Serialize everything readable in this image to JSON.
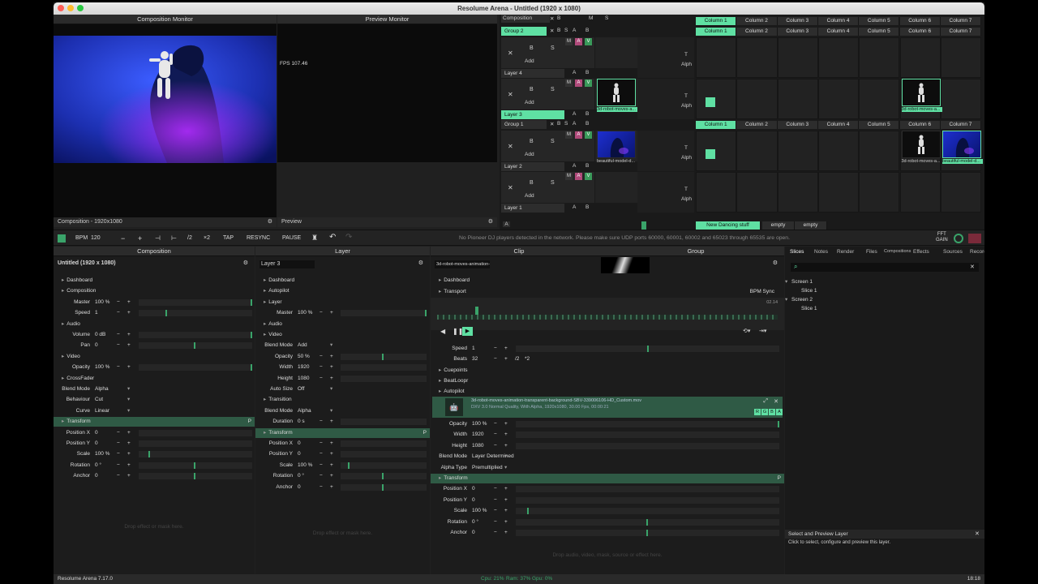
{
  "window": {
    "title": "Resolume Arena - Untitled (1920 x 1080)"
  },
  "monitors": {
    "composition_title": "Composition Monitor",
    "preview_title": "Preview Monitor",
    "fps": "FPS 107.46",
    "composition_footer": "Composition - 1920x1080",
    "preview_footer": "Preview"
  },
  "deck": {
    "comp_label": "Composition",
    "groups": [
      "Group 2",
      "Group 1"
    ],
    "layers": [
      "Layer 4",
      "Layer 3",
      "Layer 2",
      "Layer 1"
    ],
    "columns": [
      "Column 1",
      "Column 2",
      "Column 3",
      "Column 4",
      "Column 5",
      "Column 6",
      "Column 7"
    ],
    "clip_names": {
      "robot": "3d-robot-moves-a...",
      "model": "beautiful-model-d..."
    },
    "btn_labels": {
      "x": "✕",
      "b": "B",
      "s": "S",
      "add": "Add",
      "m": "M",
      "a": "A",
      "v": "V",
      "t": "T",
      "alph": "Alph"
    },
    "decks": [
      "New Dancing stuff",
      "empty",
      "empty"
    ],
    "deck_a": "A",
    "deck_b": "B"
  },
  "toolbar": {
    "bpm_label": "BPM",
    "bpm": "120",
    "minus": "−",
    "plus": "+",
    "half": "/2",
    "double": "×2",
    "tap": "TAP",
    "resync": "RESYNC",
    "pause": "PAUSE",
    "message": "No Pioneer DJ players detected in the network. Please make sure UDP ports 60000, 60001, 60002 and 65023 through 65535 are open.",
    "fft": "FFT",
    "gain": "GAIN"
  },
  "composition_panel": {
    "title": "Composition",
    "name": "Untitled (1920 x 1080)",
    "drop_hint": "Drop effect or mask here.",
    "rows": [
      {
        "t": "h",
        "label": "Dashboard"
      },
      {
        "t": "h",
        "label": "Composition"
      },
      {
        "t": "p",
        "label": "Master",
        "value": "100 %",
        "fill": 1
      },
      {
        "t": "p",
        "label": "Speed",
        "value": "1",
        "fill": 0.25
      },
      {
        "t": "h",
        "label": "Audio"
      },
      {
        "t": "p",
        "label": "Volume",
        "value": "0 dB",
        "fill": 1
      },
      {
        "t": "p",
        "label": "Pan",
        "value": "0",
        "fill": 0.5
      },
      {
        "t": "h",
        "label": "Video"
      },
      {
        "t": "p",
        "label": "Opacity",
        "value": "100 %",
        "fill": 1
      },
      {
        "t": "h",
        "label": "CrossFader"
      },
      {
        "t": "d",
        "label": "Blend Mode",
        "value": "Alpha"
      },
      {
        "t": "d",
        "label": "Behaviour",
        "value": "Cut"
      },
      {
        "t": "d",
        "label": "Curve",
        "value": "Linear"
      },
      {
        "t": "hh",
        "label": "Transform"
      },
      {
        "t": "p",
        "label": "Position X",
        "value": "0"
      },
      {
        "t": "p",
        "label": "Position Y",
        "value": "0"
      },
      {
        "t": "p",
        "label": "Scale",
        "value": "100 %",
        "fill": 0.1
      },
      {
        "t": "p",
        "label": "Rotation",
        "value": "0 °",
        "fill": 0.5
      },
      {
        "t": "p",
        "label": "Anchor",
        "value": "0",
        "fill": 0.5
      }
    ]
  },
  "layer_panel": {
    "title": "Layer",
    "name": "Layer 3",
    "drop_hint": "Drop effect or mask here.",
    "rows": [
      {
        "t": "h",
        "label": "Dashboard"
      },
      {
        "t": "h",
        "label": "Autopilot"
      },
      {
        "t": "h",
        "label": "Layer"
      },
      {
        "t": "p",
        "label": "Master",
        "value": "100 %",
        "fill": 1
      },
      {
        "t": "h",
        "label": "Audio"
      },
      {
        "t": "h",
        "label": "Video"
      },
      {
        "t": "d",
        "label": "Blend Mode",
        "value": "Add"
      },
      {
        "t": "p",
        "label": "Opacity",
        "value": "50 %",
        "fill": 0.5
      },
      {
        "t": "p",
        "label": "Width",
        "value": "1920"
      },
      {
        "t": "p",
        "label": "Height",
        "value": "1080"
      },
      {
        "t": "d",
        "label": "Auto Size",
        "value": "Off"
      },
      {
        "t": "h",
        "label": "Transition"
      },
      {
        "t": "d",
        "label": "Blend Mode",
        "value": "Alpha"
      },
      {
        "t": "p",
        "label": "Duration",
        "value": "0 s"
      },
      {
        "t": "hh",
        "label": "Transform"
      },
      {
        "t": "p",
        "label": "Position X",
        "value": "0"
      },
      {
        "t": "p",
        "label": "Position Y",
        "value": "0"
      },
      {
        "t": "p",
        "label": "Scale",
        "value": "100 %",
        "fill": 0.1
      },
      {
        "t": "p",
        "label": "Rotation",
        "value": "0 °",
        "fill": 0.5
      },
      {
        "t": "p",
        "label": "Anchor",
        "value": "0",
        "fill": 0.5
      }
    ]
  },
  "clip_panel": {
    "title": "Clip",
    "group_title": "Group",
    "name": "3d-robot-moves-animation-...",
    "bpm_sync": "BPM Sync",
    "time": "02.14",
    "speed_label": "Speed",
    "speed": "1",
    "beats_label": "Beats",
    "beats": "32",
    "half": "/2",
    "double": "*2",
    "file_name": "3d-robot-moves-animation-transparent-background-SBV-339006106-HD_Custom.mov",
    "file_info": "DXV 3.0 Normal Quality, With Alpha, 1920x1080, 30.00 Fps, 00:00:21",
    "rgba": [
      "R",
      "G",
      "B",
      "A"
    ],
    "drop_hint": "Drop audio, video, mask, source or effect here.",
    "sections": [
      "Dashboard",
      "Transport",
      "Cuepoints",
      "BeatLoopr",
      "Autopilot"
    ],
    "rows": [
      {
        "t": "p",
        "label": "Opacity",
        "value": "100 %",
        "fill": 1
      },
      {
        "t": "p",
        "label": "Width",
        "value": "1920"
      },
      {
        "t": "p",
        "label": "Height",
        "value": "1080"
      },
      {
        "t": "d",
        "label": "Blend Mode",
        "value": "Layer Determined"
      },
      {
        "t": "d",
        "label": "Alpha Type",
        "value": "Premultiplied"
      },
      {
        "t": "hh",
        "label": "Transform"
      },
      {
        "t": "p",
        "label": "Position X",
        "value": "0"
      },
      {
        "t": "p",
        "label": "Position Y",
        "value": "0"
      },
      {
        "t": "p",
        "label": "Scale",
        "value": "100 %",
        "fill": 0.05
      },
      {
        "t": "p",
        "label": "Rotation",
        "value": "0 °",
        "fill": 0.5
      },
      {
        "t": "p",
        "label": "Anchor",
        "value": "0",
        "fill": 0.5
      }
    ]
  },
  "browser": {
    "tabs": [
      "Slices",
      "Notes",
      "Render",
      "Files",
      "Compositions",
      "Effects",
      "Sources",
      "Record"
    ],
    "tree": [
      {
        "label": "Screen 1",
        "children": [
          "Slice 1"
        ]
      },
      {
        "label": "Screen 2",
        "children": [
          "Slice 1"
        ]
      }
    ],
    "help_title": "Select and Preview Layer",
    "help_text": "Click to select, configure and preview this layer."
  },
  "status": {
    "version": "Resolume Arena 7.17.0",
    "cpu": "Cpu: 21%",
    "ram": "Ram: 37%",
    "gpu": "Gpu: 0%",
    "clock": "18:18"
  }
}
